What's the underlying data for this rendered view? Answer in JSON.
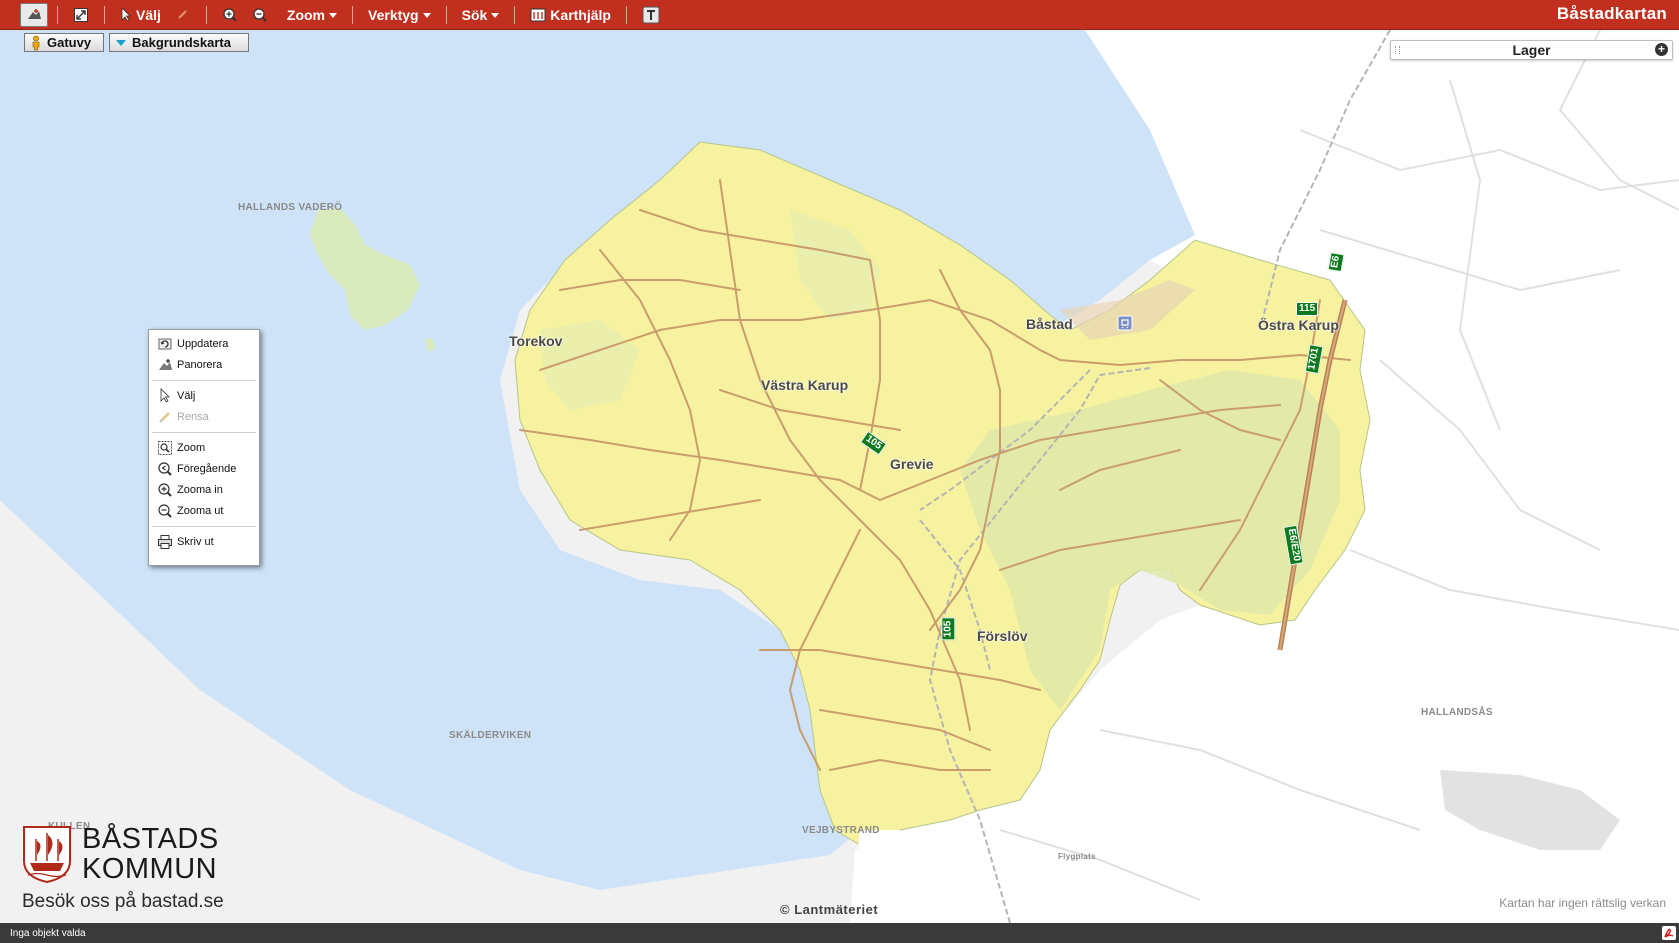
{
  "app_title": "Båstadkartan",
  "toolbar": {
    "select_label": "Välj",
    "zoom_label": "Zoom",
    "tools_label": "Verktyg",
    "search_label": "Sök",
    "help_label": "Karthjälp"
  },
  "map_buttons": {
    "street_view": "Gatuvy",
    "background_map": "Bakgrundskarta"
  },
  "layers_panel": {
    "title": "Lager"
  },
  "context_menu": {
    "items": [
      {
        "label": "Uppdatera",
        "icon": "refresh-icon"
      },
      {
        "label": "Panorera",
        "icon": "pan-icon"
      },
      {
        "label": "Välj",
        "icon": "cursor-icon"
      },
      {
        "label": "Rensa",
        "icon": "eraser-icon",
        "disabled": true
      },
      {
        "label": "Zoom",
        "icon": "zoom-box-icon"
      },
      {
        "label": "Föregående",
        "icon": "previous-zoom-icon"
      },
      {
        "label": "Zooma in",
        "icon": "zoom-in-icon"
      },
      {
        "label": "Zooma ut",
        "icon": "zoom-out-icon"
      },
      {
        "label": "Skriv ut",
        "icon": "print-icon"
      }
    ]
  },
  "places": {
    "torekov": "Torekov",
    "vastra_karup": "Västra Karup",
    "bastad": "Båstad",
    "ostra_karup": "Östra Karup",
    "grevie": "Grevie",
    "forslov": "Förslöv",
    "hallands_vadero": "HALLANDS VADERÖ",
    "skalderviken": "SKÄLDERVIKEN",
    "hallandsas": "HALLANDSÅS",
    "vejbystrand": "VEJBYSTRAND",
    "kullen": "KULLEN",
    "flygplats": "Flygplats"
  },
  "road_numbers": {
    "r105a": "105",
    "r105b": "105",
    "r1701": "1701",
    "r115": "115",
    "e6": "E6/E20",
    "e6top": "E6"
  },
  "logo": {
    "line1": "BÅSTADS",
    "line2": "KOMMUN",
    "tagline": "Besök oss på bastad.se"
  },
  "copyright": "© Lantmäteriet",
  "disclaimer": "Kartan har ingen rättslig verkan",
  "status": "Inga objekt valda",
  "colors": {
    "toolbar": "#c1301e",
    "sea": "#cfe3f8",
    "municipality": "#f6f2a0",
    "roads": "#c8996a",
    "road_badge": "#0e7a1e"
  }
}
